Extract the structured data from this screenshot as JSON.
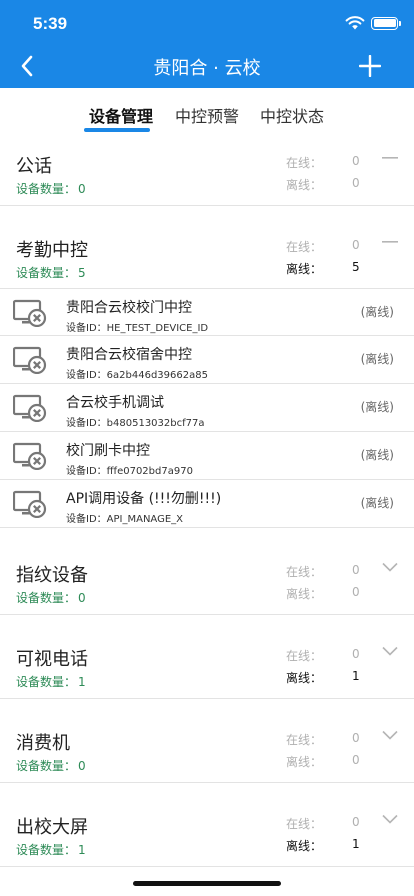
{
  "status_bar": {
    "time": "5:39"
  },
  "nav": {
    "title": "贵阳合 · 云校"
  },
  "tabs": [
    "设备管理",
    "中控预警",
    "中控状态"
  ],
  "labels": {
    "count": "设备数量：",
    "online": "在线：",
    "offline": "离线：",
    "device_id": "设备ID："
  },
  "groups": [
    {
      "name": "公话",
      "count": "0",
      "online": "0",
      "offline": "0",
      "expanded": true
    },
    {
      "name": "考勤中控",
      "count": "5",
      "online": "0",
      "offline": "5",
      "expanded": true
    },
    {
      "name": "指纹设备",
      "count": "0",
      "online": "0",
      "offline": "0",
      "expanded": false
    },
    {
      "name": "可视电话",
      "count": "1",
      "online": "0",
      "offline": "1",
      "expanded": false
    },
    {
      "name": "消费机",
      "count": "0",
      "online": "0",
      "offline": "0",
      "expanded": false
    },
    {
      "name": "出校大屏",
      "count": "1",
      "online": "0",
      "offline": "1",
      "expanded": false
    }
  ],
  "devices": [
    {
      "name": "贵阳合云校校门中控",
      "id": "HE_TEST_DEVICE_ID",
      "status": "(离线)"
    },
    {
      "name": "贵阳合云校宿舍中控",
      "id": "6a2b446d39662a85",
      "status": "(离线)"
    },
    {
      "name": "合云校手机调试",
      "id": "b480513032bcf77a",
      "status": "(离线)"
    },
    {
      "name": "校门刷卡中控",
      "id": "fffe0702bd7a970",
      "status": "(离线)"
    },
    {
      "name": "API调用设备 (!!!勿删!!!)",
      "id": "API_MANAGE_X",
      "status": "(离线)"
    }
  ],
  "colors": {
    "primary": "#1a87e6",
    "count_green": "#2e8b57",
    "muted": "#b0b0b0"
  },
  "icons": {
    "back": "chevron-left-icon",
    "add": "plus-icon",
    "device": "monitor-offline-icon",
    "collapse": "minus-icon",
    "expand": "chevron-down-icon"
  }
}
